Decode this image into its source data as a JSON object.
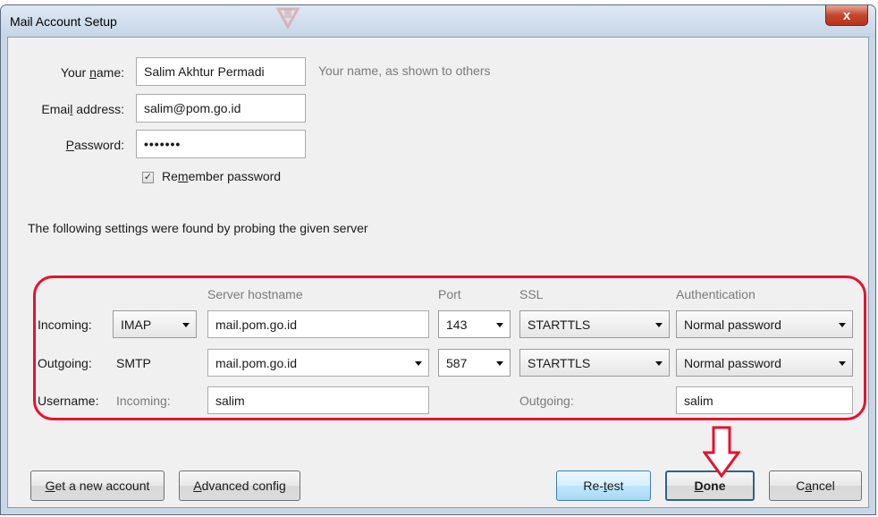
{
  "window": {
    "title": "Mail Account Setup",
    "close_glyph": "x"
  },
  "identity": {
    "your_name_label_pre": "Your ",
    "your_name_label_u": "n",
    "your_name_label_post": "ame:",
    "your_name_value": "Salim Akhtur Permadi",
    "your_name_hint": "Your name, as shown to others",
    "email_label_pre": "Emai",
    "email_label_u": "l",
    "email_label_post": " address:",
    "email_value": "salim@pom.go.id",
    "password_label_u": "P",
    "password_label_post": "assword:",
    "password_value": "•••••••",
    "remember_pre": "Re",
    "remember_u": "m",
    "remember_post": "ember password",
    "remember_checked": "✓"
  },
  "probe_message": "The following settings were found by probing the given server",
  "server_settings": {
    "headers": {
      "hostname": "Server hostname",
      "port": "Port",
      "ssl": "SSL",
      "auth": "Authentication"
    },
    "incoming": {
      "label": "Incoming:",
      "protocol": "IMAP",
      "hostname": "mail.pom.go.id",
      "port": "143",
      "ssl": "STARTTLS",
      "auth": "Normal password"
    },
    "outgoing": {
      "label": "Outgoing:",
      "protocol": "SMTP",
      "hostname": "mail.pom.go.id",
      "port": "587",
      "ssl": "STARTTLS",
      "auth": "Normal password"
    },
    "username": {
      "label": "Username:",
      "incoming_label": "Incoming:",
      "incoming_value": "salim",
      "outgoing_label": "Outgoing:",
      "outgoing_value": "salim"
    }
  },
  "buttons": {
    "get_new_account_u": "G",
    "get_new_account_post": "et a new account",
    "advanced_config_u": "A",
    "advanced_config_post": "dvanced config",
    "retest_pre": "Re-",
    "retest_u": "t",
    "retest_post": "est",
    "done_u": "D",
    "done_post": "one",
    "cancel_pre": "C",
    "cancel_u": "a",
    "cancel_post": "ncel"
  },
  "colors": {
    "highlight": "#e8112d",
    "accent_border": "#2c628b"
  },
  "icons": [
    "close-icon",
    "dropdown-arrow-icon",
    "checkmark-icon",
    "down-arrow-annotation-icon"
  ]
}
